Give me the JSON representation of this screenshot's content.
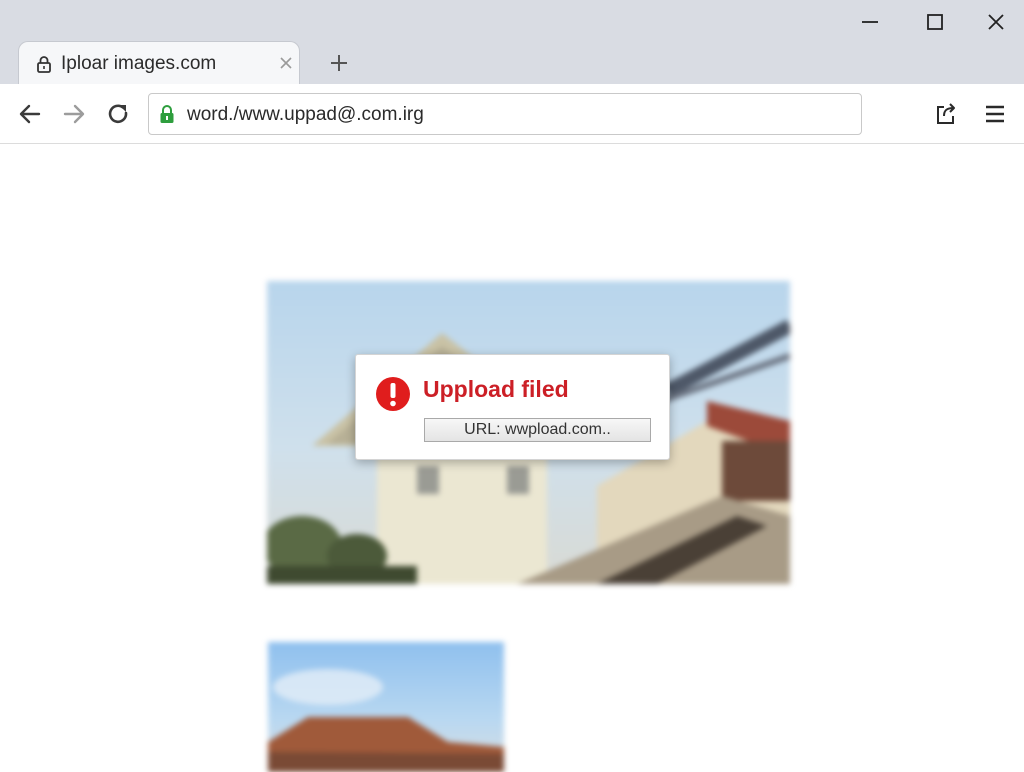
{
  "window": {
    "minimize_icon": "minimize-icon",
    "maximize_icon": "maximize-icon",
    "close_icon": "close-icon"
  },
  "tab": {
    "title": "Iploar images.com",
    "lock_icon": "lock-icon",
    "close_icon": "close-icon"
  },
  "new_tab_icon": "plus-icon",
  "toolbar": {
    "back_icon": "arrow-left-icon",
    "forward_icon": "arrow-right-icon",
    "reload_icon": "reload-icon",
    "url": "word./www.uppad@.com.irg",
    "secure_lock_icon": "lock-icon",
    "share_icon": "share-icon",
    "menu_icon": "hamburger-menu-icon"
  },
  "dialog": {
    "title": "Uppload filed",
    "url_text": "URL: wwpload.com..",
    "icon": "error-icon"
  },
  "colors": {
    "error_red": "#cc1f26",
    "lock_green": "#2e9e3e",
    "tabstrip": "#d9dce3"
  }
}
